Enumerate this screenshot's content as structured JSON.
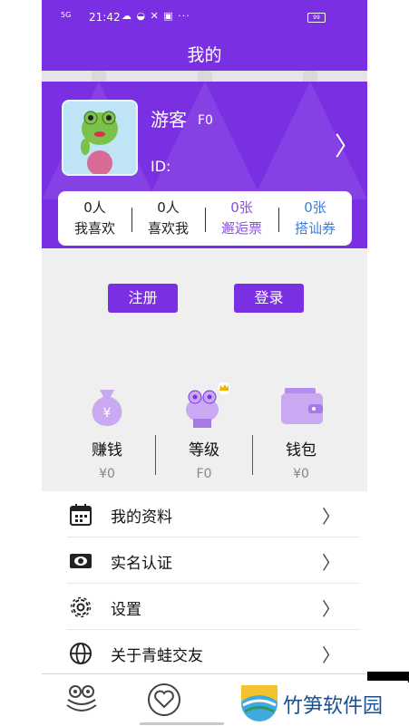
{
  "status_bar": {
    "signal": "5G",
    "time": "21:42",
    "icons": "☁ ◒ ✕ ▣ ···",
    "battery": "99"
  },
  "header": {
    "title": "我的"
  },
  "profile": {
    "name": "游客",
    "level_tag": "F0",
    "id_label": "ID:",
    "arrow": "〉"
  },
  "stats": [
    {
      "value": "0人",
      "label": "我喜欢"
    },
    {
      "value": "0人",
      "label": "喜欢我"
    },
    {
      "value": "0张",
      "label": "邂逅票"
    },
    {
      "value": "0张",
      "label": "搭讪券"
    }
  ],
  "buttons": {
    "register": "注册",
    "login": "登录"
  },
  "features": [
    {
      "label": "赚钱",
      "value": "¥0",
      "icon": "money-bag-icon"
    },
    {
      "label": "等级",
      "value": "F0",
      "icon": "frog-crown-icon"
    },
    {
      "label": "钱包",
      "value": "¥0",
      "icon": "wallet-icon"
    }
  ],
  "menu": [
    {
      "label": "我的资料",
      "icon": "calendar-icon",
      "chevron": "〉"
    },
    {
      "label": "实名认证",
      "icon": "id-card-icon",
      "chevron": "〉"
    },
    {
      "label": "设置",
      "icon": "gear-icon",
      "chevron": "〉"
    },
    {
      "label": "关于青蛙交友",
      "icon": "globe-icon",
      "chevron": "〉"
    }
  ],
  "watermark": {
    "text": "竹笋软件园"
  },
  "colors": {
    "primary": "#7b2fe3",
    "accent_purple": "#8a4fe0",
    "accent_blue": "#3d7fd8"
  }
}
